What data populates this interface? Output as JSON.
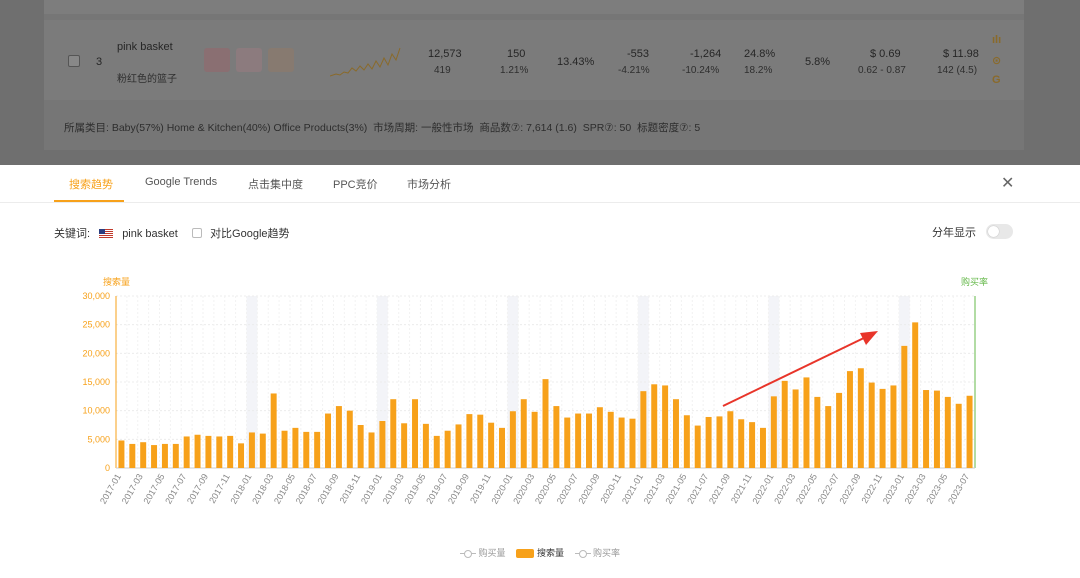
{
  "product_row": {
    "rank": "3",
    "name": "pink basket",
    "name_cn": "粉红色的篮子",
    "searches": "12,573",
    "searches_sub": "419",
    "col2": "150",
    "col2_sub": "1.21%",
    "col3": "13.43%",
    "col4": "-553",
    "col4_sub": "-4.21%",
    "col5": "-1,264",
    "col5_sub": "-10.24%",
    "col6": "24.8%",
    "col6_sub": "18.2%",
    "col7": "5.8%",
    "col8": "$ 0.69",
    "col8_sub": "0.62 - 0.87",
    "col9": "$ 11.98",
    "col9_sub": "142 (4.5)",
    "icon_names": [
      "bar-chart-icon",
      "more-icon",
      "google-icon"
    ]
  },
  "meta": {
    "label_category": "所属类目:",
    "cat1": "Baby(57%)",
    "cat2": "Home & Kitchen(40%)",
    "cat3": "Office Products(3%)",
    "cycle": "市场周期: 一般性市场",
    "products": "商品数⑦: 7,614 (1.6)",
    "spr": "SPR⑦: 50",
    "title_density": "标题密度⑦: 5"
  },
  "tabs": [
    "搜索趋势",
    "Google Trends",
    "点击集中度",
    "PPC竞价",
    "市场分析"
  ],
  "close_label": "✕",
  "keyword": {
    "label": "关键词:",
    "value": "pink basket",
    "flag": "us-flag-icon"
  },
  "compare_label": "对比Google趋势",
  "year_toggle_label": "分年显示",
  "chart_data": {
    "type": "bar",
    "left_axis_title": "搜索量",
    "right_axis_title": "购买率",
    "yticks": [
      "30,000",
      "25,000",
      "20,000",
      "15,000",
      "10,000",
      "5,000",
      "0"
    ],
    "ylim": [
      0,
      30000
    ],
    "grid": true,
    "legend_position": "bottom",
    "accent_color": "#f7a11a",
    "right_axis_color": "#65b84a",
    "categories": [
      "2017-01",
      "2017-02",
      "2017-03",
      "2017-04",
      "2017-05",
      "2017-06",
      "2017-07",
      "2017-08",
      "2017-09",
      "2017-10",
      "2017-11",
      "2017-12",
      "2018-01",
      "2018-02",
      "2018-03",
      "2018-04",
      "2018-05",
      "2018-06",
      "2018-07",
      "2018-08",
      "2018-09",
      "2018-10",
      "2018-11",
      "2018-12",
      "2019-01",
      "2019-02",
      "2019-03",
      "2019-04",
      "2019-05",
      "2019-06",
      "2019-07",
      "2019-08",
      "2019-09",
      "2019-10",
      "2019-11",
      "2019-12",
      "2020-01",
      "2020-02",
      "2020-03",
      "2020-04",
      "2020-05",
      "2020-06",
      "2020-07",
      "2020-08",
      "2020-09",
      "2020-10",
      "2020-11",
      "2020-12",
      "2021-01",
      "2021-02",
      "2021-03",
      "2021-04",
      "2021-05",
      "2021-06",
      "2021-07",
      "2021-08",
      "2021-09",
      "2021-10",
      "2021-11",
      "2021-12",
      "2022-01",
      "2022-02",
      "2022-03",
      "2022-04",
      "2022-05",
      "2022-06",
      "2022-07",
      "2022-08",
      "2022-09",
      "2022-10",
      "2022-11",
      "2022-12",
      "2023-01",
      "2023-02",
      "2023-03",
      "2023-04",
      "2023-05",
      "2023-06",
      "2023-07"
    ],
    "xtick_labels": [
      "2017-01",
      "2017-03",
      "2017-05",
      "2017-07",
      "2017-09",
      "2017-11",
      "2018-01",
      "2018-03",
      "2018-05",
      "2018-07",
      "2018-09",
      "2018-11",
      "2019-01",
      "2019-03",
      "2019-05",
      "2019-07",
      "2019-09",
      "2019-11",
      "2020-01",
      "2020-03",
      "2020-05",
      "2020-07",
      "2020-09",
      "2020-11",
      "2021-01",
      "2021-03",
      "2021-05",
      "2021-07",
      "2021-09",
      "2021-11",
      "2022-01",
      "2022-03",
      "2022-05",
      "2022-07",
      "2022-09",
      "2022-11",
      "2023-01",
      "2023-03",
      "2023-05",
      "2023-07"
    ],
    "series": [
      {
        "name": "搜索量",
        "values": [
          4800,
          4200,
          4500,
          4000,
          4200,
          4200,
          5500,
          5800,
          5600,
          5500,
          5600,
          4300,
          6200,
          6000,
          13000,
          6500,
          7000,
          6300,
          6300,
          9500,
          10800,
          10000,
          7500,
          6200,
          8200,
          12000,
          7800,
          12000,
          7700,
          5600,
          6500,
          7600,
          9400,
          9300,
          7900,
          7000,
          9900,
          12000,
          9800,
          15500,
          10800,
          8800,
          9500,
          9500,
          10600,
          9800,
          8800,
          8600,
          13400,
          14600,
          14400,
          12000,
          9200,
          7400,
          8900,
          9000,
          9900,
          8500,
          8000,
          7000,
          12500,
          15200,
          13700,
          15800,
          12400,
          10800,
          13100,
          16900,
          17400,
          14900,
          13800,
          14400,
          21300,
          25400,
          13600,
          13500,
          12400,
          11200,
          12600
        ]
      }
    ],
    "legend": [
      "购买量",
      "搜索量",
      "购买率"
    ]
  }
}
